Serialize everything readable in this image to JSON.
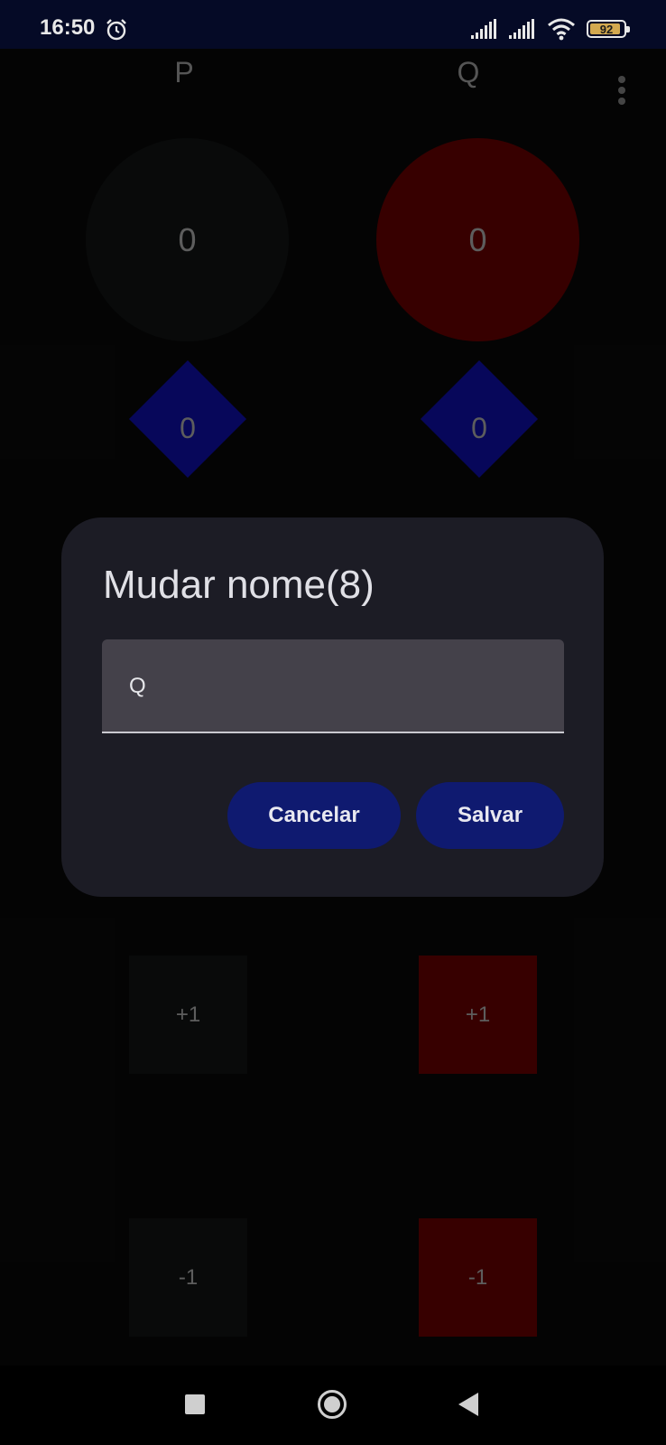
{
  "status_bar": {
    "time": "16:50",
    "icons": [
      "alarm-icon",
      "signal-icon",
      "signal-icon",
      "wifi-icon",
      "battery-icon"
    ],
    "battery": "92",
    "battery_level": 0.92
  },
  "players": [
    {
      "name": "P",
      "circle_value": "0",
      "circle_color": "#141818",
      "diamond_value": "0",
      "plus_label": "+1",
      "minus_label": "-1",
      "square_color": "#141818"
    },
    {
      "name": "Q",
      "circle_value": "0",
      "circle_color": "#7a0000",
      "diamond_value": "0",
      "plus_label": "+1",
      "minus_label": "-1",
      "square_color": "#7a0000"
    }
  ],
  "menu": {
    "icon": "more-vert-icon"
  },
  "dialog": {
    "title": "Mudar nome(8)",
    "input_value": "Q",
    "cancel_label": "Cancelar",
    "save_label": "Salvar"
  },
  "colors": {
    "diamond": "#1010c8",
    "dialog_button": "#0f1a70",
    "status_bar_bg": "#050a26"
  },
  "nav_bar": {
    "icons": [
      "recents-icon",
      "home-icon",
      "back-icon"
    ]
  }
}
